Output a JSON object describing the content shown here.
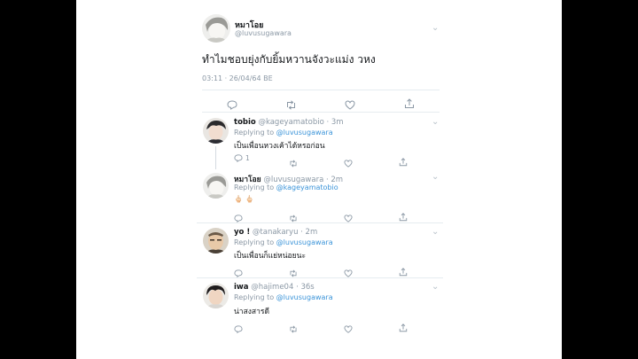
{
  "main": {
    "display_name": "หมาโอย",
    "handle": "@luvusugawara",
    "text": "ทำไมชอบยุ่งกับยิ้มหวานจังวะแม่ง วหง",
    "timestamp": "03:11 · 26/04/64 BE"
  },
  "replies": [
    {
      "display_name": "tobio",
      "handle": "@kageyamatobio",
      "time": "· 3m",
      "replying_prefix": "Replying to",
      "replying_to": "@luvusugawara",
      "text": "เป็นเพื่อนหวงเค้าได้หรอก่อน",
      "reply_count": "1"
    },
    {
      "display_name": "หมาโอย",
      "handle": "@luvusugawara",
      "time": "· 2m",
      "replying_prefix": "Replying to",
      "replying_to": "@kageyamatobio",
      "text": "🖕🏻 🖕🏻"
    },
    {
      "display_name": "yo !",
      "handle": "@tanakaryu",
      "time": "· 2m",
      "replying_prefix": "Replying to",
      "replying_to": "@luvusugawara",
      "text": "เป็นเพื่อนก็แย่หน่อยนะ"
    },
    {
      "display_name": "iwa",
      "handle": "@hajime04",
      "time": "· 36s",
      "replying_prefix": "Replying to",
      "replying_to": "@luvusugawara",
      "text": "น่าสงสารดี"
    }
  ],
  "icons": [
    "reply-icon",
    "retweet-icon",
    "like-icon",
    "share-icon",
    "chevron-down-icon"
  ],
  "colors": {
    "background": "#000000",
    "page": "#ffffff",
    "link": "#3b94d9",
    "secondary": "#8b98a5"
  }
}
